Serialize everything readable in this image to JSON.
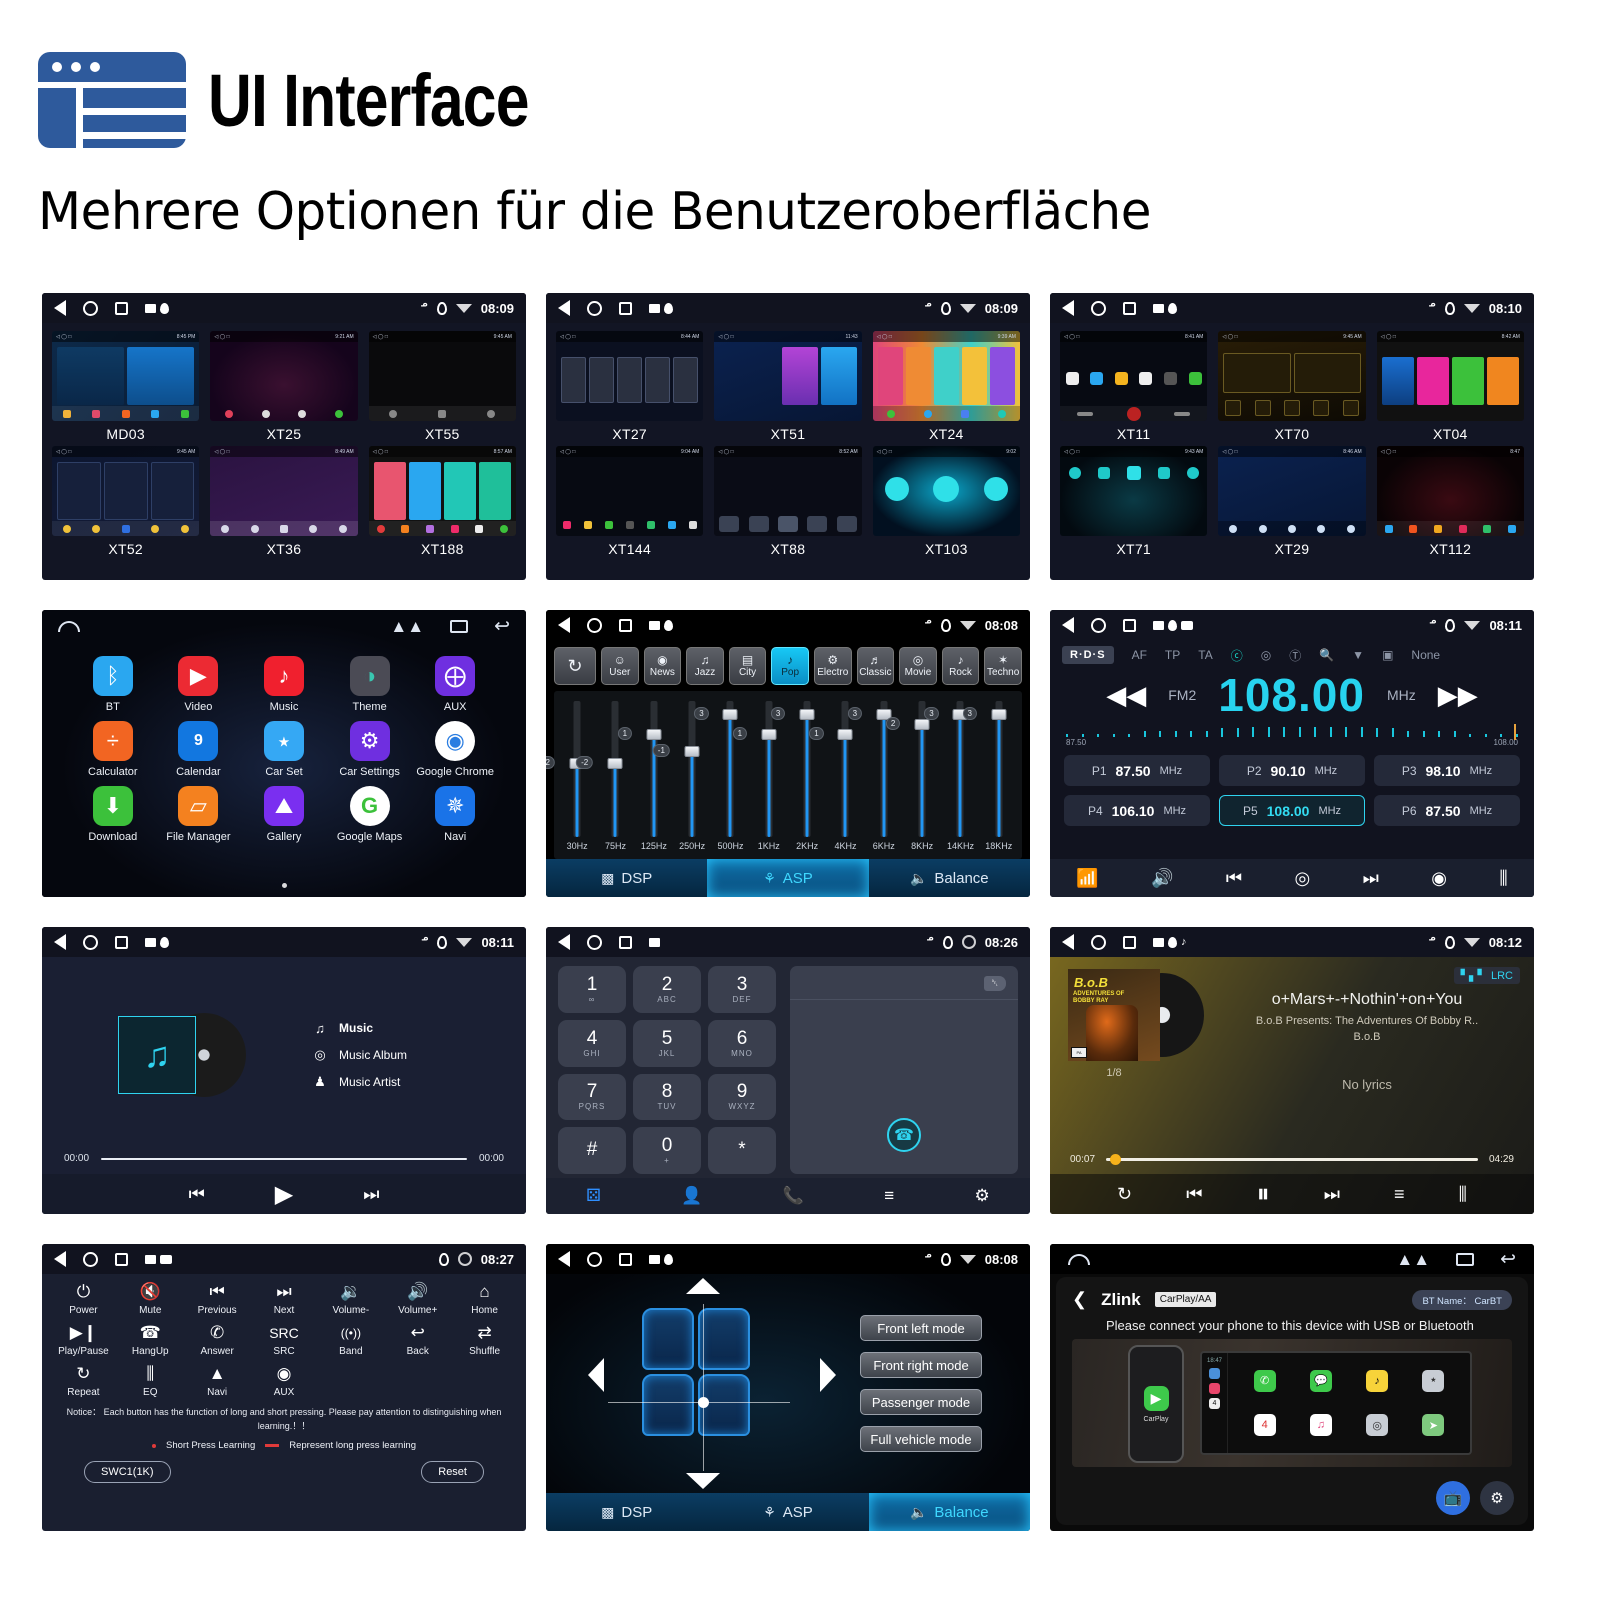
{
  "header": {
    "brand_title": "UI Interface",
    "subtitle": "Mehrere Optionen für die Benutzeroberfläche"
  },
  "mosaics": [
    {
      "status_time": "08:09",
      "items": [
        "MD03",
        "XT25",
        "XT55",
        "XT52",
        "XT36",
        "XT188"
      ]
    },
    {
      "status_time": "08:09",
      "items": [
        "XT27",
        "XT51",
        "XT24",
        "XT144",
        "XT88",
        "XT103"
      ]
    },
    {
      "status_time": "08:10",
      "items": [
        "XT11",
        "XT70",
        "XT04",
        "XT71",
        "XT29",
        "XT112"
      ]
    }
  ],
  "launcher": {
    "apps": [
      {
        "label": "BT",
        "icon": "bluetooth-icon",
        "glyph": "ᛒ",
        "color": "#2aa7f0"
      },
      {
        "label": "Video",
        "icon": "video-icon",
        "glyph": "▶",
        "color": "#ec2a33"
      },
      {
        "label": "Music",
        "icon": "music-icon",
        "glyph": "♪",
        "color": "#f0202e"
      },
      {
        "label": "Theme",
        "icon": "theme-icon",
        "glyph": "◑",
        "color": "#4b4b55"
      },
      {
        "label": "AUX",
        "icon": "aux-icon",
        "glyph": "⨁",
        "color": "#6f2fe0"
      },
      {
        "label": "Calculator",
        "icon": "calculator-icon",
        "glyph": "÷",
        "color": "#f26522"
      },
      {
        "label": "Calendar",
        "icon": "calendar-icon",
        "glyph": "9",
        "color": "#1277e0"
      },
      {
        "label": "Car Set",
        "icon": "car-icon",
        "glyph": "⭑",
        "color": "#35a8f4"
      },
      {
        "label": "Car Settings",
        "icon": "gear-icon",
        "glyph": "⚙",
        "color": "#6f2fe0"
      },
      {
        "label": "Google Chrome",
        "icon": "chrome-icon",
        "glyph": "◉",
        "color": "#ffffff"
      },
      {
        "label": "Download",
        "icon": "download-icon",
        "glyph": "⬇",
        "color": "#3cc13b"
      },
      {
        "label": "File Manager",
        "icon": "folder-icon",
        "glyph": "▱",
        "color": "#f4811f"
      },
      {
        "label": "Gallery",
        "icon": "gallery-icon",
        "glyph": "⛰",
        "color": "#7a2ff0"
      },
      {
        "label": "Google Maps",
        "icon": "maps-icon",
        "glyph": "G",
        "color": "#ffffff"
      },
      {
        "label": "Navi",
        "icon": "navi-icon",
        "glyph": "✵",
        "color": "#1a73e8"
      }
    ]
  },
  "equalizer": {
    "status_time": "08:08",
    "reset_label": "↻",
    "presets": [
      {
        "label": "User",
        "icon": "user-icon",
        "glyph": "☺",
        "active": false
      },
      {
        "label": "News",
        "icon": "news-icon",
        "glyph": "◉",
        "active": false
      },
      {
        "label": "Jazz",
        "icon": "saxophone-icon",
        "glyph": "♫",
        "active": false
      },
      {
        "label": "City",
        "icon": "city-icon",
        "glyph": "▤",
        "active": false
      },
      {
        "label": "Pop",
        "icon": "microphone-icon",
        "glyph": "♪",
        "active": true
      },
      {
        "label": "Electro",
        "icon": "electro-icon",
        "glyph": "⚙",
        "active": false
      },
      {
        "label": "Classic",
        "icon": "classic-icon",
        "glyph": "♬",
        "active": false
      },
      {
        "label": "Movie",
        "icon": "movie-icon",
        "glyph": "◎",
        "active": false
      },
      {
        "label": "Rock",
        "icon": "guitar-icon",
        "glyph": "♪",
        "active": false
      },
      {
        "label": "Techno",
        "icon": "techno-icon",
        "glyph": "✶",
        "active": false
      }
    ],
    "bands": [
      {
        "freq": "30Hz",
        "value": "-2"
      },
      {
        "freq": "75Hz",
        "value": "-2"
      },
      {
        "freq": "125Hz",
        "value": "1"
      },
      {
        "freq": "250Hz",
        "value": "-1"
      },
      {
        "freq": "500Hz",
        "value": "3"
      },
      {
        "freq": "1KHz",
        "value": "1"
      },
      {
        "freq": "2KHz",
        "value": "3"
      },
      {
        "freq": "4KHz",
        "value": "1"
      },
      {
        "freq": "6KHz",
        "value": "3"
      },
      {
        "freq": "8KHz",
        "value": "2"
      },
      {
        "freq": "14KHz",
        "value": "3"
      },
      {
        "freq": "18KHz",
        "value": "3"
      }
    ],
    "tabs": [
      {
        "label": "DSP",
        "icon": "dsp-icon",
        "active": false
      },
      {
        "label": "ASP",
        "icon": "asp-icon",
        "active": true
      },
      {
        "label": "Balance",
        "icon": "balance-icon",
        "active": false
      }
    ]
  },
  "radio": {
    "status_time": "08:11",
    "rds_badge": "R·D·S",
    "options": [
      "AF",
      "TP",
      "TA"
    ],
    "none_label": "None",
    "band": "FM2",
    "frequency": "108.00",
    "unit": "MHz",
    "scale_min": "87.50",
    "scale_max": "108.00",
    "presets": [
      {
        "name": "P1",
        "freq": "87.50",
        "unit": "MHz",
        "selected": false
      },
      {
        "name": "P2",
        "freq": "90.10",
        "unit": "MHz",
        "selected": false
      },
      {
        "name": "P3",
        "freq": "98.10",
        "unit": "MHz",
        "selected": false
      },
      {
        "name": "P4",
        "freq": "106.10",
        "unit": "MHz",
        "selected": false
      },
      {
        "name": "P5",
        "freq": "108.00",
        "unit": "MHz",
        "selected": true
      },
      {
        "name": "P6",
        "freq": "87.50",
        "unit": "MHz",
        "selected": false
      }
    ]
  },
  "bt_music": {
    "status_time": "08:11",
    "lines": [
      {
        "icon": "music-note-icon",
        "glyph": "♫",
        "text": "Music"
      },
      {
        "icon": "album-icon",
        "glyph": "◎",
        "text": "Music Album"
      },
      {
        "icon": "artist-icon",
        "glyph": "♟",
        "text": "Music Artist"
      }
    ],
    "time_elapsed": "00:00",
    "time_total": "00:00"
  },
  "dialer": {
    "status_time": "08:26",
    "keys": [
      {
        "num": "1",
        "sub": "∞"
      },
      {
        "num": "2",
        "sub": "ABC"
      },
      {
        "num": "3",
        "sub": "DEF"
      },
      {
        "num": "4",
        "sub": "GHI"
      },
      {
        "num": "5",
        "sub": "JKL"
      },
      {
        "num": "6",
        "sub": "MNO"
      },
      {
        "num": "7",
        "sub": "PQRS"
      },
      {
        "num": "8",
        "sub": "TUV"
      },
      {
        "num": "9",
        "sub": "WXYZ"
      },
      {
        "num": "#",
        "sub": ""
      },
      {
        "num": "0",
        "sub": "+"
      },
      {
        "num": "*",
        "sub": ""
      }
    ],
    "input_value": "",
    "bottom_icons": [
      "dialpad-icon",
      "contacts-icon",
      "call-log-icon",
      "playlist-icon",
      "settings-icon"
    ]
  },
  "now_playing": {
    "status_time": "08:12",
    "lrc_label": "LRC",
    "title": "o+Mars+-+Nothin'+on+You",
    "album": "B.o.B Presents: The Adventures Of Bobby R..",
    "artist": "B.o.B",
    "lyrics": "No lyrics",
    "track_index": "1/8",
    "cover_title": "B.o.B",
    "cover_sub": "ADVENTURES OF BOBBY RAY",
    "time_elapsed": "00:07",
    "time_total": "04:29"
  },
  "swc": {
    "status_time": "08:27",
    "buttons": [
      {
        "label": "Power",
        "icon": "power-icon",
        "glyph": "⏻"
      },
      {
        "label": "Mute",
        "icon": "mute-icon",
        "glyph": "🔇"
      },
      {
        "label": "Previous",
        "icon": "previous-icon",
        "glyph": "⏮"
      },
      {
        "label": "Next",
        "icon": "next-icon",
        "glyph": "⏭"
      },
      {
        "label": "Volume-",
        "icon": "volume-down-icon",
        "glyph": "🔉"
      },
      {
        "label": "Volume+",
        "icon": "volume-up-icon",
        "glyph": "🔊"
      },
      {
        "label": "Home",
        "icon": "home-icon",
        "glyph": "⌂"
      },
      {
        "label": "Play/Pause",
        "icon": "play-pause-icon",
        "glyph": "▶❙"
      },
      {
        "label": "HangUp",
        "icon": "hangup-icon",
        "glyph": "☎"
      },
      {
        "label": "Answer",
        "icon": "answer-icon",
        "glyph": "✆"
      },
      {
        "label": "SRC",
        "icon": "source-icon",
        "glyph": "SRC"
      },
      {
        "label": "Band",
        "icon": "band-icon",
        "glyph": "((•))"
      },
      {
        "label": "Back",
        "icon": "back-icon",
        "glyph": "↩"
      },
      {
        "label": "Shuffle",
        "icon": "shuffle-icon",
        "glyph": "⇄"
      },
      {
        "label": "Repeat",
        "icon": "repeat-icon",
        "glyph": "↻"
      },
      {
        "label": "EQ",
        "icon": "eq-icon",
        "glyph": "⫼"
      },
      {
        "label": "Navi",
        "icon": "navi-icon",
        "glyph": "▲"
      },
      {
        "label": "AUX",
        "icon": "aux-icon",
        "glyph": "◉"
      }
    ],
    "notice": "Notice： Each button has the function of long and short pressing. Please pay attention to distinguishing when learning.！！",
    "legend_short": "Short Press Learning",
    "legend_long": "Represent long press learning",
    "btn_swc": "SWC1(1K)",
    "btn_reset": "Reset"
  },
  "balance": {
    "status_time": "08:08",
    "modes": [
      "Front left mode",
      "Front right mode",
      "Passenger mode",
      "Full vehicle mode"
    ],
    "tabs": [
      {
        "label": "DSP",
        "icon": "dsp-icon",
        "active": false
      },
      {
        "label": "ASP",
        "icon": "asp-icon",
        "active": false
      },
      {
        "label": "Balance",
        "icon": "balance-icon",
        "active": true
      }
    ]
  },
  "zlink": {
    "title": "Zlink",
    "badge": "CarPlay/AA",
    "bt_name": "BT Name： CarBT",
    "instruction": "Please connect your phone to this device with USB or Bluetooth",
    "phone_label": "CarPlay",
    "hu_time": "18:47",
    "hu_apps": [
      {
        "label": "Phone",
        "color": "#3ec94b",
        "glyph": "✆"
      },
      {
        "label": "Message",
        "color": "#3ec94b",
        "glyph": "💬"
      },
      {
        "label": "QQ music",
        "color": "#f7d33a",
        "glyph": "♪"
      },
      {
        "label": "Car",
        "color": "#c8cdd4",
        "glyph": "⭑"
      },
      {
        "label": "Calendar",
        "color": "#ffffff",
        "glyph": "4"
      },
      {
        "label": "Music",
        "color": "#ffffff",
        "glyph": "♫"
      },
      {
        "label": "Setting",
        "color": "#c8cdd4",
        "glyph": "◎"
      },
      {
        "label": "Map",
        "color": "#7ec97e",
        "glyph": "➤"
      }
    ]
  }
}
